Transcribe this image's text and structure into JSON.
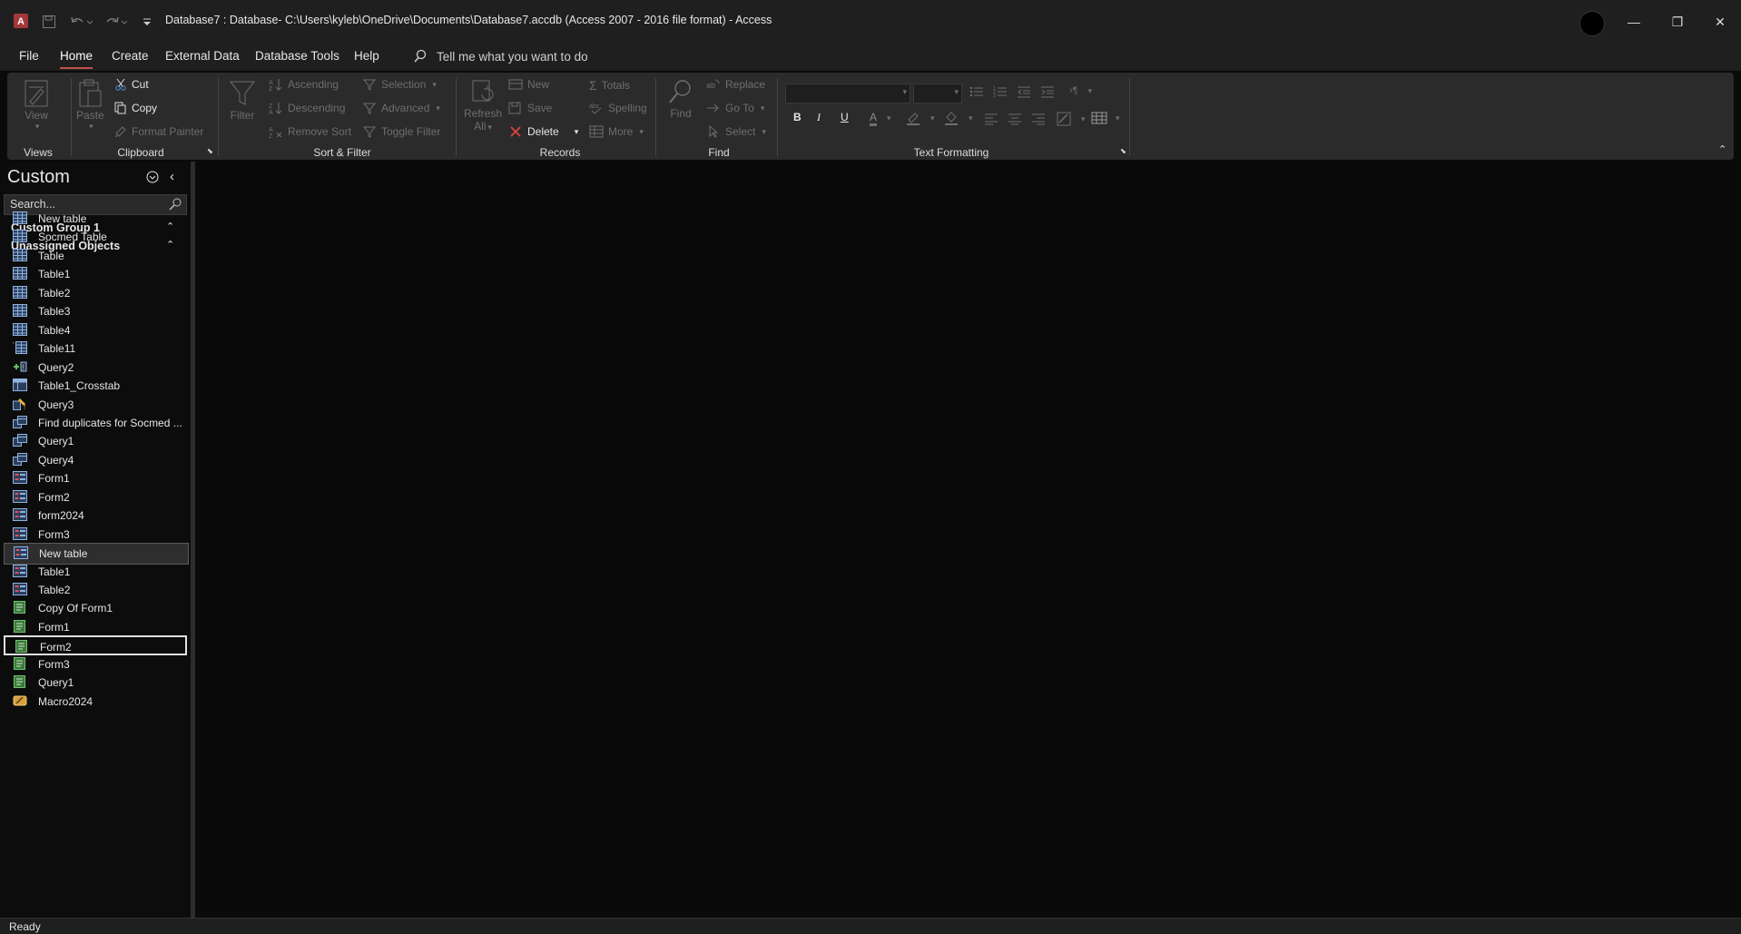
{
  "window": {
    "title": "Database7 : Database- C:\\Users\\kyleb\\OneDrive\\Documents\\Database7.accdb (Access 2007 - 2016 file format)  -  Access",
    "app_icon": "access-logo-icon",
    "buttons": {
      "minimize": "—",
      "restore": "❐",
      "close": "✕"
    }
  },
  "menu": {
    "tabs": [
      "File",
      "Home",
      "Create",
      "External Data",
      "Database Tools",
      "Help"
    ],
    "active": "Home",
    "tell_me": "Tell me what you want to do"
  },
  "ribbon": {
    "groups": {
      "views": "Views",
      "clipboard": "Clipboard",
      "sort_filter": "Sort & Filter",
      "records": "Records",
      "find": "Find",
      "text_formatting": "Text Formatting"
    },
    "views": {
      "view": "View"
    },
    "clipboard": {
      "paste": "Paste",
      "cut": "Cut",
      "copy": "Copy",
      "format_painter": "Format Painter"
    },
    "sort_filter": {
      "filter": "Filter",
      "ascending": "Ascending",
      "descending": "Descending",
      "remove_sort": "Remove Sort",
      "selection": "Selection",
      "advanced": "Advanced",
      "toggle_filter": "Toggle Filter"
    },
    "records": {
      "refresh": "Refresh",
      "refresh_sub": "All",
      "new": "New",
      "save": "Save",
      "delete": "Delete",
      "totals": "Totals",
      "spelling": "Spelling",
      "more": "More"
    },
    "find": {
      "find": "Find",
      "replace": "Replace",
      "goto": "Go To",
      "select": "Select"
    },
    "text_formatting": {
      "bold": "B",
      "italic": "I",
      "underline": "U",
      "font_color": "A"
    }
  },
  "nav_pane": {
    "title": "Custom",
    "search_placeholder": "Search...",
    "group1": "Custom Group 1",
    "group2": "Unassigned Objects",
    "items": [
      {
        "label": "New table",
        "icon": "table-icon"
      },
      {
        "label": "Socmed Table",
        "icon": "table-icon"
      },
      {
        "label": "Table",
        "icon": "table-icon"
      },
      {
        "label": "Table1",
        "icon": "table-icon"
      },
      {
        "label": "Table2",
        "icon": "table-icon"
      },
      {
        "label": "Table3",
        "icon": "table-icon"
      },
      {
        "label": "Table4",
        "icon": "table-icon"
      },
      {
        "label": "Table11",
        "icon": "linked-table-icon"
      },
      {
        "label": "Query2",
        "icon": "append-query-icon"
      },
      {
        "label": "Table1_Crosstab",
        "icon": "crosstab-query-icon"
      },
      {
        "label": "Query3",
        "icon": "update-query-icon"
      },
      {
        "label": "Find duplicates for Socmed ...",
        "icon": "select-query-icon"
      },
      {
        "label": "Query1",
        "icon": "select-query-icon"
      },
      {
        "label": "Query4",
        "icon": "select-query-icon"
      },
      {
        "label": "Form1",
        "icon": "form-icon"
      },
      {
        "label": "Form2",
        "icon": "form-icon"
      },
      {
        "label": "form2024",
        "icon": "form-icon"
      },
      {
        "label": "Form3",
        "icon": "form-icon"
      },
      {
        "label": "New table",
        "icon": "form-icon"
      },
      {
        "label": "Table1",
        "icon": "form-icon"
      },
      {
        "label": "Table2",
        "icon": "form-icon"
      },
      {
        "label": "Copy Of Form1",
        "icon": "report-icon"
      },
      {
        "label": "Form1",
        "icon": "report-icon"
      },
      {
        "label": "Form2",
        "icon": "report-icon"
      },
      {
        "label": "Form3",
        "icon": "report-icon"
      },
      {
        "label": "Query1",
        "icon": "report-icon"
      },
      {
        "label": "Macro2024",
        "icon": "macro-icon"
      }
    ],
    "selected_index": 18,
    "focused_index": 23
  },
  "status": {
    "text": "Ready"
  }
}
